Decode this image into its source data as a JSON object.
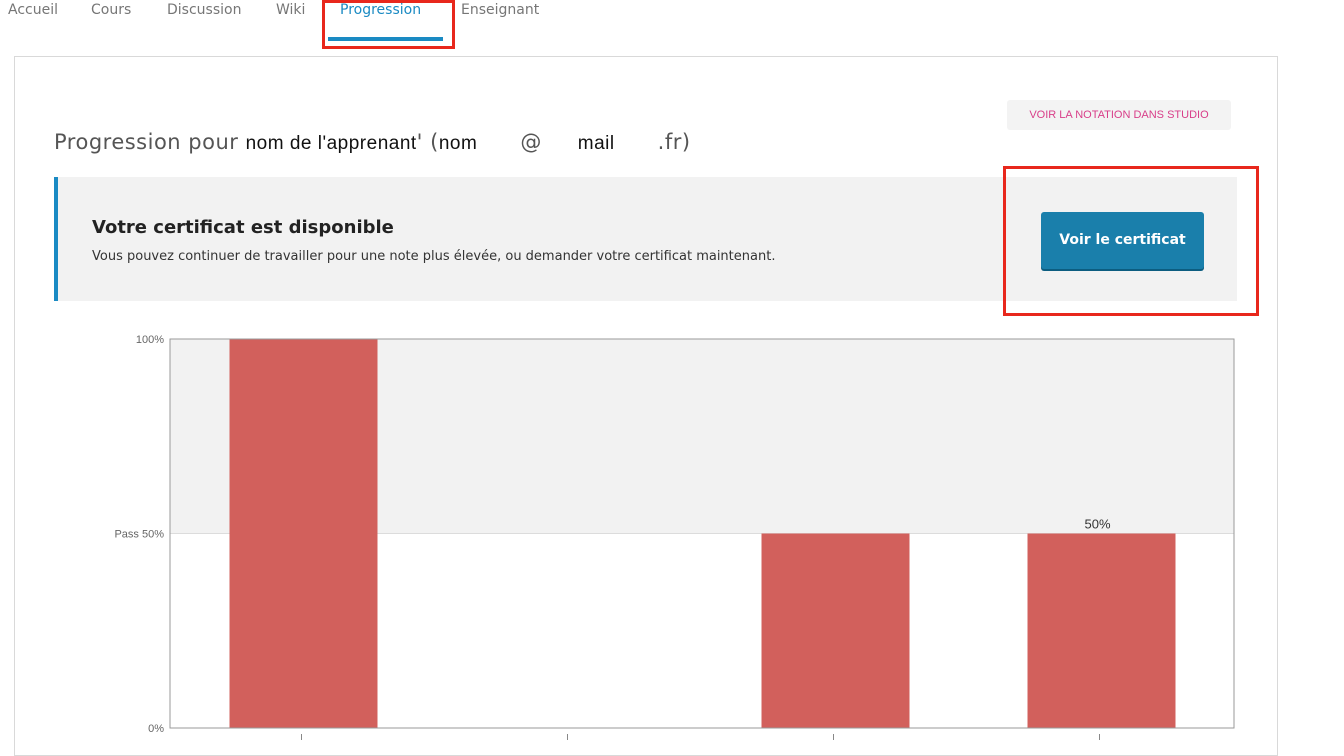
{
  "tabs": [
    {
      "label": "Accueil",
      "active": false
    },
    {
      "label": "Cours",
      "active": false
    },
    {
      "label": "Discussion",
      "active": false
    },
    {
      "label": "Wiki",
      "active": false
    },
    {
      "label": "Progression",
      "active": true
    },
    {
      "label": "Enseignant",
      "active": false
    }
  ],
  "studio_button_label": "VOIR LA NOTATION DANS STUDIO",
  "progress_title": {
    "prefix": "Progression pour ",
    "learner_name": "nom de l'apprenant",
    "mid": "' (",
    "email_user": "nom",
    "at": "@",
    "email_domain": "mail",
    "suffix": ".fr)"
  },
  "certificate": {
    "title": "Votre certificat est disponible",
    "description": "Vous pouvez continuer de travailler pour une note plus élevée, ou demander votre certificat maintenant.",
    "button_label": "Voir le certificat"
  },
  "colors": {
    "accent": "#1a8ac3",
    "highlight": "#e8271c",
    "bar": "#d2605c",
    "studio_text": "#d83e89"
  },
  "chart_data": {
    "type": "bar",
    "categories": [
      "",
      "",
      "",
      ""
    ],
    "values": [
      100,
      0,
      50,
      50
    ],
    "ylim": [
      0,
      100
    ],
    "yticks": [
      {
        "value": 100,
        "label": "100%"
      },
      {
        "value": 50,
        "label": "Pass 50%"
      },
      {
        "value": 0,
        "label": "0%"
      }
    ],
    "pass_threshold": 50,
    "data_labels": [
      "",
      "",
      "",
      "50%"
    ],
    "grid": true
  }
}
